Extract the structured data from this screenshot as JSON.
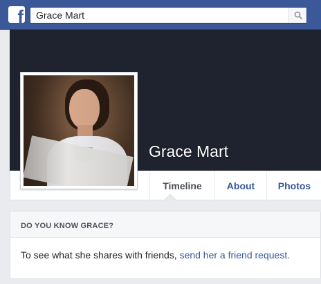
{
  "topbar": {
    "logo_icon": "facebook-f-icon",
    "search_value": "Grace Mart",
    "search_icon": "search-icon",
    "brand_color": "#3b5998"
  },
  "profile": {
    "name": "Grace Mart",
    "photo_icon": "profile-photo"
  },
  "nav": {
    "tabs": [
      {
        "label": "Timeline",
        "active": true
      },
      {
        "label": "About",
        "active": false
      },
      {
        "label": "Photos",
        "active": false
      }
    ]
  },
  "friend_card": {
    "title": "DO YOU KNOW GRACE?",
    "text": "To see what she shares with friends,",
    "link": "send her a friend request."
  }
}
